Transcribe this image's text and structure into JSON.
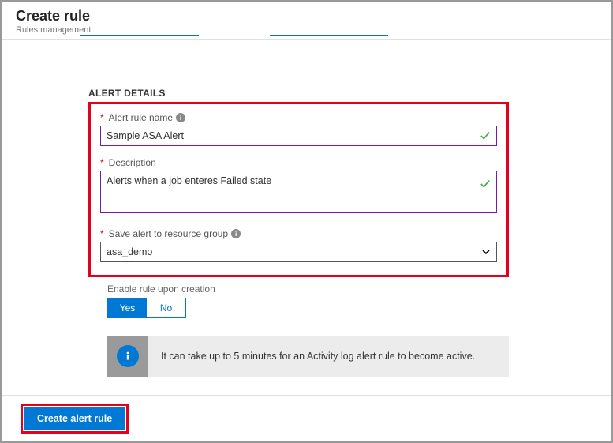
{
  "header": {
    "title": "Create rule",
    "subtitle": "Rules management"
  },
  "section": {
    "title": "ALERT DETAILS"
  },
  "alertRuleName": {
    "label": "Alert rule name",
    "value": "Sample ASA Alert"
  },
  "description": {
    "label": "Description",
    "value": "Alerts when a job enteres Failed state"
  },
  "resourceGroup": {
    "label": "Save alert to resource group",
    "value": "asa_demo"
  },
  "enableRule": {
    "label": "Enable rule upon creation",
    "yes": "Yes",
    "no": "No"
  },
  "notice": {
    "text": "It can take up to 5 minutes for an Activity log alert rule to become active."
  },
  "footer": {
    "createBtn": "Create alert rule"
  }
}
